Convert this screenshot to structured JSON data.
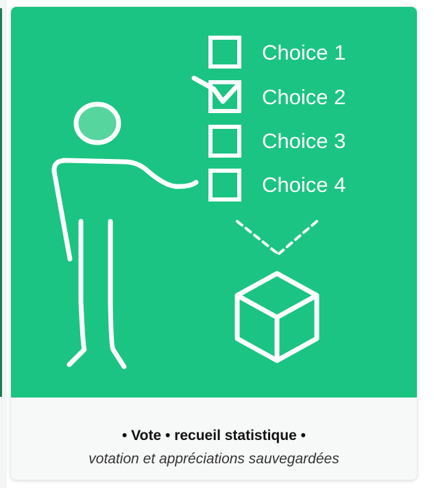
{
  "card": {
    "choices": [
      "Choice 1",
      "Choice 2",
      "Choice 3",
      "Choice 4"
    ],
    "checked_choice_index": 1,
    "title": "• Vote • recueil statistique •",
    "subtitle": "votation et appréciations sauvegardées"
  },
  "colors": {
    "accent_green": "#1bc482",
    "head_fill": "#56d59f",
    "line_white": "#ffffff",
    "footer_bg": "#f7f8f8"
  },
  "icons": [
    "person-figure-icon",
    "checkbox-icon",
    "checkmark-icon",
    "box-icon"
  ]
}
